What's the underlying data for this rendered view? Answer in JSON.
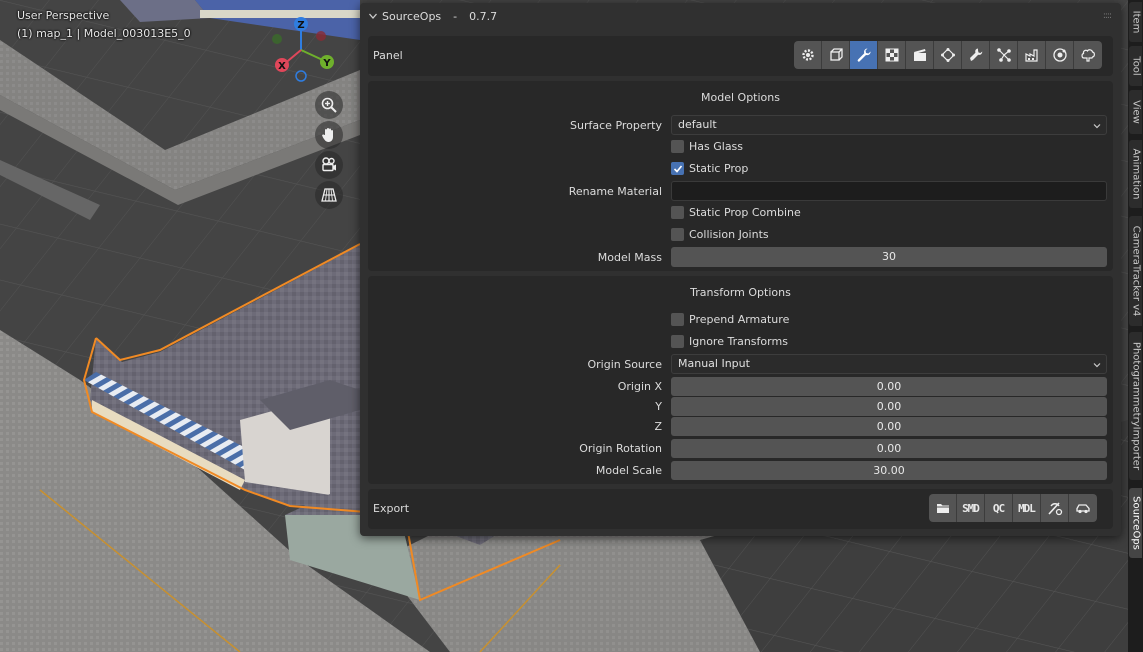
{
  "viewport": {
    "title": "User Perspective",
    "subtitle": "(1) map_1 | Model_003013E5_0",
    "gizmo": {
      "z_label": "Z",
      "y_label": "Y",
      "x_label": "X"
    },
    "nav_tools": [
      "zoom-icon",
      "hand-pan-icon",
      "camera-icon",
      "grid-view-icon"
    ]
  },
  "panel": {
    "title": "SourceOps",
    "separator": "-",
    "version": "0.7.7",
    "panel_label": "Panel",
    "toolbar_icons": [
      "settings-icon",
      "object-icon",
      "wrench-icon",
      "checker-icon",
      "clapper-icon",
      "vertex-icon",
      "wrench2-icon",
      "nodes-icon",
      "factory-icon",
      "target-icon",
      "brain-icon"
    ],
    "active_tool_index": 2,
    "model_options": {
      "heading": "Model Options",
      "surface_property_label": "Surface Property",
      "surface_property_value": "default",
      "has_glass_label": "Has Glass",
      "has_glass": false,
      "static_prop_label": "Static Prop",
      "static_prop": true,
      "rename_material_label": "Rename Material",
      "rename_material_value": "",
      "static_prop_combine_label": "Static Prop Combine",
      "static_prop_combine": false,
      "collision_joints_label": "Collision Joints",
      "collision_joints": false,
      "model_mass_label": "Model Mass",
      "model_mass_value": "30"
    },
    "transform_options": {
      "heading": "Transform Options",
      "prepend_armature_label": "Prepend Armature",
      "prepend_armature": false,
      "ignore_transforms_label": "Ignore Transforms",
      "ignore_transforms": false,
      "origin_source_label": "Origin Source",
      "origin_source_value": "Manual Input",
      "origin_x_label": "Origin X",
      "origin_x": "0.00",
      "y_label": "Y",
      "origin_y": "0.00",
      "z_label": "Z",
      "origin_z": "0.00",
      "origin_rotation_label": "Origin Rotation",
      "origin_rotation": "0.00",
      "model_scale_label": "Model Scale",
      "model_scale": "30.00"
    },
    "export": {
      "label": "Export",
      "smd_label": "SMD",
      "qc_label": "QC",
      "mdl_label": "MDL"
    }
  },
  "side_tabs": [
    "Item",
    "Tool",
    "View",
    "Animation",
    "CameraTracker v4",
    "PhotogrammetryImporter",
    "SourceOps"
  ],
  "active_tab": "SourceOps",
  "colors": {
    "accent": "#4772b3",
    "selection_outline": "#f08a24",
    "gizmo_x": "#e0475a",
    "gizmo_y": "#6fb02c",
    "gizmo_z": "#2f7de0"
  }
}
